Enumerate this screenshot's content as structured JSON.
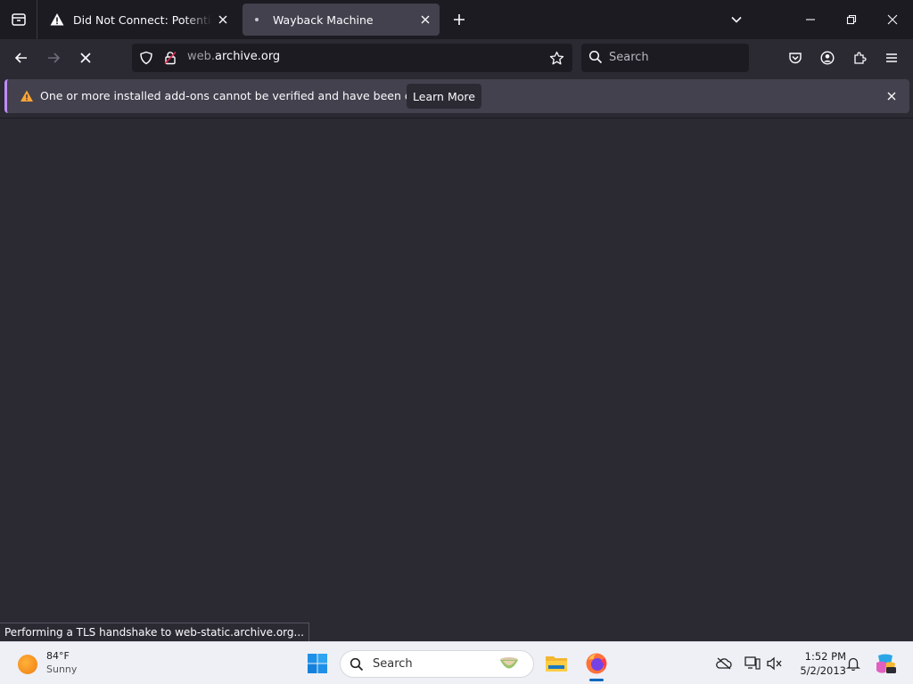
{
  "browser": {
    "tabs": [
      {
        "title": "Did Not Connect: Potential Security Issue",
        "active": false,
        "icon": "warning-icon"
      },
      {
        "title": "Wayback Machine",
        "active": true,
        "icon": "loading-dot-icon"
      }
    ],
    "url": {
      "prefix": "web.",
      "domain": "archive.org"
    },
    "search_placeholder": "Search",
    "notification": {
      "message": "One or more installed add-ons cannot be verified and have been disabled.",
      "button": "Learn More"
    },
    "status_text": "Performing a TLS handshake to web-static.archive.org..."
  },
  "taskbar": {
    "weather": {
      "temp": "84°F",
      "condition": "Sunny"
    },
    "search_placeholder": "Search",
    "time": "1:52 PM",
    "date": "5/2/2013"
  },
  "colors": {
    "chrome_dark": "#1c1b22",
    "toolbar": "#2b2a33",
    "active_tab": "#42414d",
    "accent": "#c08cff",
    "windows_blue": "#0067c0"
  }
}
